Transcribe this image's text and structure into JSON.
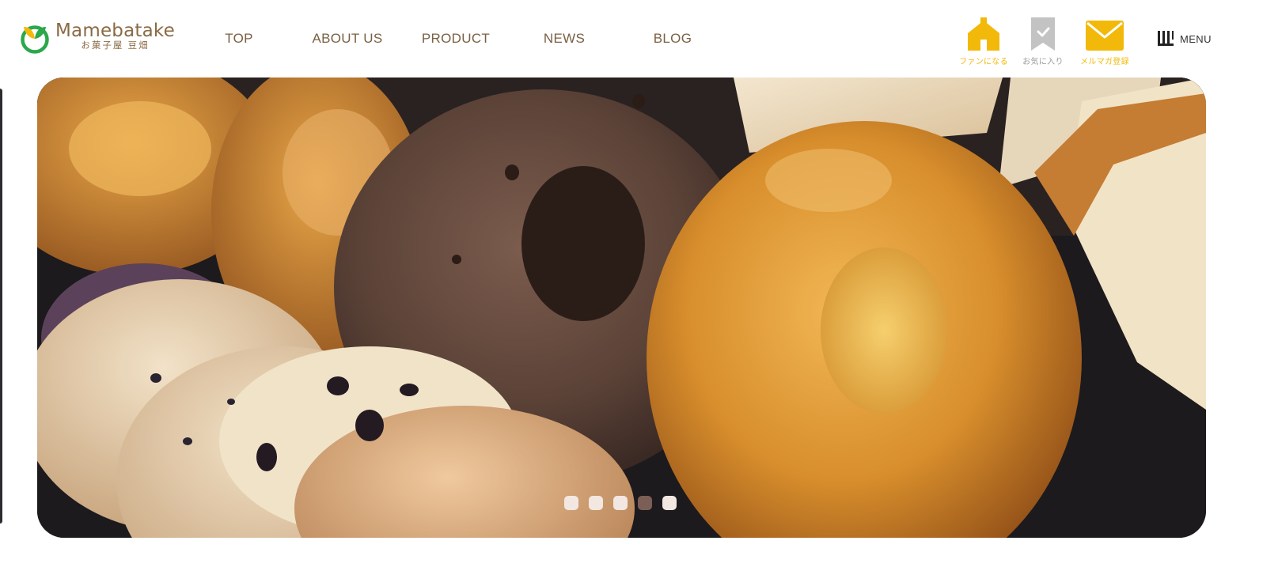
{
  "header": {
    "logo": {
      "name": "Mamebatake",
      "subtitle": "お菓子屋 豆畑"
    },
    "nav": [
      {
        "label": "TOP"
      },
      {
        "label": "ABOUT US"
      },
      {
        "label": "PRODUCT"
      },
      {
        "label": "NEWS"
      },
      {
        "label": "BLOG"
      }
    ],
    "actions": [
      {
        "label": "ファンになる",
        "icon": "house-icon",
        "color": "#f2b90a"
      },
      {
        "label": "お気に入り",
        "icon": "bookmark-icon",
        "color": "#c3c3c3"
      },
      {
        "label": "メルマガ登録",
        "icon": "mail-icon",
        "color": "#f2b90a"
      }
    ],
    "menu": {
      "label": "MENU",
      "icon": "menu-bars-icon"
    }
  },
  "hero": {
    "image": "baked-goods-photo",
    "slides_total": 5,
    "active_slide": 4
  },
  "colors": {
    "brand_brown": "#8a6a45",
    "brand_green": "#2aa84a",
    "accent_yellow": "#f2b90a",
    "nav_text": "#7a6044",
    "dot_inactive": "#f3e7e1",
    "dot_active": "#7b5f57"
  }
}
